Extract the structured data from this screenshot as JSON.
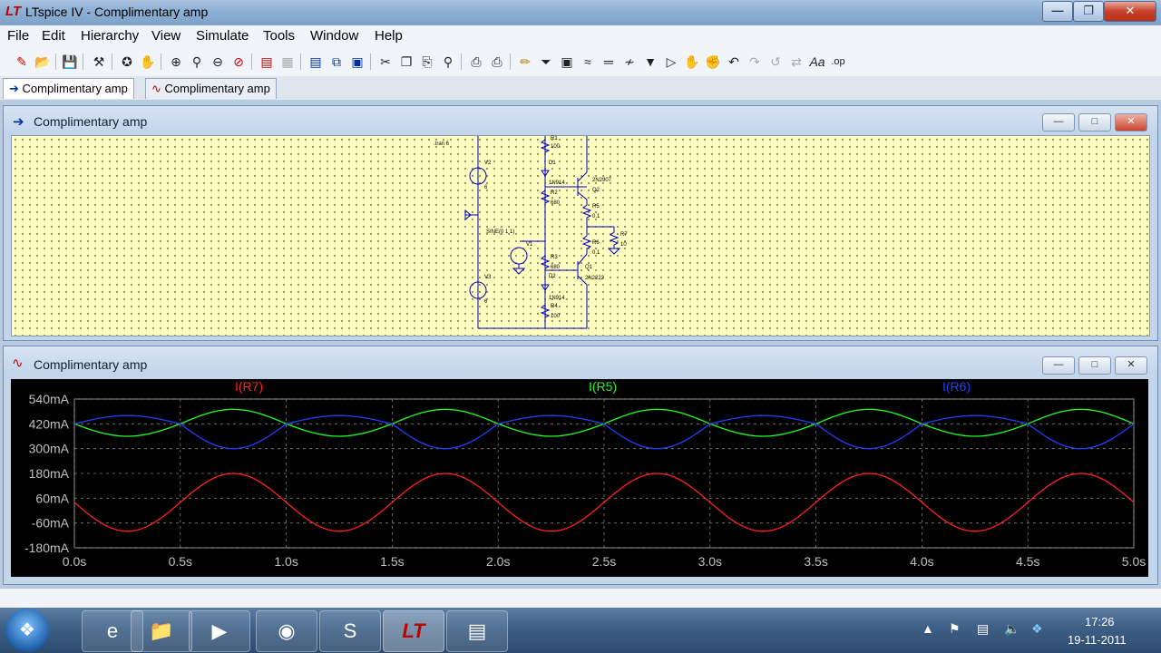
{
  "window": {
    "title": "LTspice IV - Complimentary amp"
  },
  "menu": [
    "File",
    "Edit",
    "Hierarchy",
    "View",
    "Simulate",
    "Tools",
    "Window",
    "Help"
  ],
  "tabs": [
    {
      "label": "Complimentary amp",
      "icon": "schematic-icon",
      "active": true
    },
    {
      "label": "Complimentary amp",
      "icon": "waveform-icon",
      "active": false
    }
  ],
  "schematic": {
    "title": "Complimentary amp",
    "directive": ".tran 6",
    "labels": {
      "r1": "R1",
      "r1v": "100",
      "d1": "D1",
      "d1m": "1N914",
      "r2": "R2",
      "r2v": "680",
      "q2m": "2N2907",
      "q2": "Q2",
      "r5": "R5",
      "r5v": "0.1",
      "r7": "R7",
      "r7v": "10",
      "r6": "R6",
      "r6v": "0.1",
      "q1": "Q1",
      "q1m": "2N2222",
      "v2": "V2",
      "v2v": "6",
      "v3": "V3",
      "v3v": "6",
      "sine": "SINE(0 1 1)",
      "v1": "V1",
      "r3": "R3",
      "r3v": "680",
      "d2": "D2",
      "d2m": "1N914",
      "r4": "R4",
      "r4v": "100"
    }
  },
  "waveform": {
    "title": "Complimentary amp",
    "traces": [
      {
        "name": "I(R7)",
        "color": "#ff2020"
      },
      {
        "name": "I(R5)",
        "color": "#20ff20"
      },
      {
        "name": "I(R6)",
        "color": "#2040ff"
      }
    ],
    "y_ticks": [
      "540mA",
      "420mA",
      "300mA",
      "180mA",
      "60mA",
      "-60mA",
      "-180mA"
    ],
    "x_ticks": [
      "0.0s",
      "0.5s",
      "1.0s",
      "1.5s",
      "2.0s",
      "2.5s",
      "3.0s",
      "3.5s",
      "4.0s",
      "4.5s",
      "5.0s"
    ]
  },
  "chart_data": {
    "type": "line",
    "xlabel": "",
    "ylabel": "",
    "xlim": [
      0,
      5
    ],
    "ylim": [
      -180,
      540
    ],
    "x": [
      0,
      0.25,
      0.5,
      0.75,
      1,
      1.25,
      1.5,
      1.75,
      2,
      2.25,
      2.5,
      2.75,
      3,
      3.25,
      3.5,
      3.75,
      4,
      4.25,
      4.5,
      4.75,
      5
    ],
    "series": [
      {
        "name": "I(R7)",
        "color": "#ff2020",
        "values": [
          40,
          -100,
          40,
          180,
          40,
          -100,
          40,
          180,
          40,
          -100,
          40,
          180,
          40,
          -100,
          40,
          180,
          40,
          -100,
          40,
          180,
          40
        ]
      },
      {
        "name": "I(R5)",
        "color": "#20ff20",
        "values": [
          420,
          360,
          420,
          490,
          420,
          360,
          420,
          490,
          420,
          360,
          420,
          490,
          420,
          360,
          420,
          490,
          420,
          360,
          420,
          490,
          420
        ]
      },
      {
        "name": "I(R6)",
        "color": "#2040ff",
        "values": [
          420,
          460,
          420,
          300,
          420,
          460,
          420,
          300,
          420,
          460,
          420,
          300,
          420,
          460,
          420,
          300,
          420,
          460,
          420,
          300,
          420
        ]
      }
    ]
  },
  "taskbar": {
    "time": "17:26",
    "date": "19-11-2011"
  }
}
